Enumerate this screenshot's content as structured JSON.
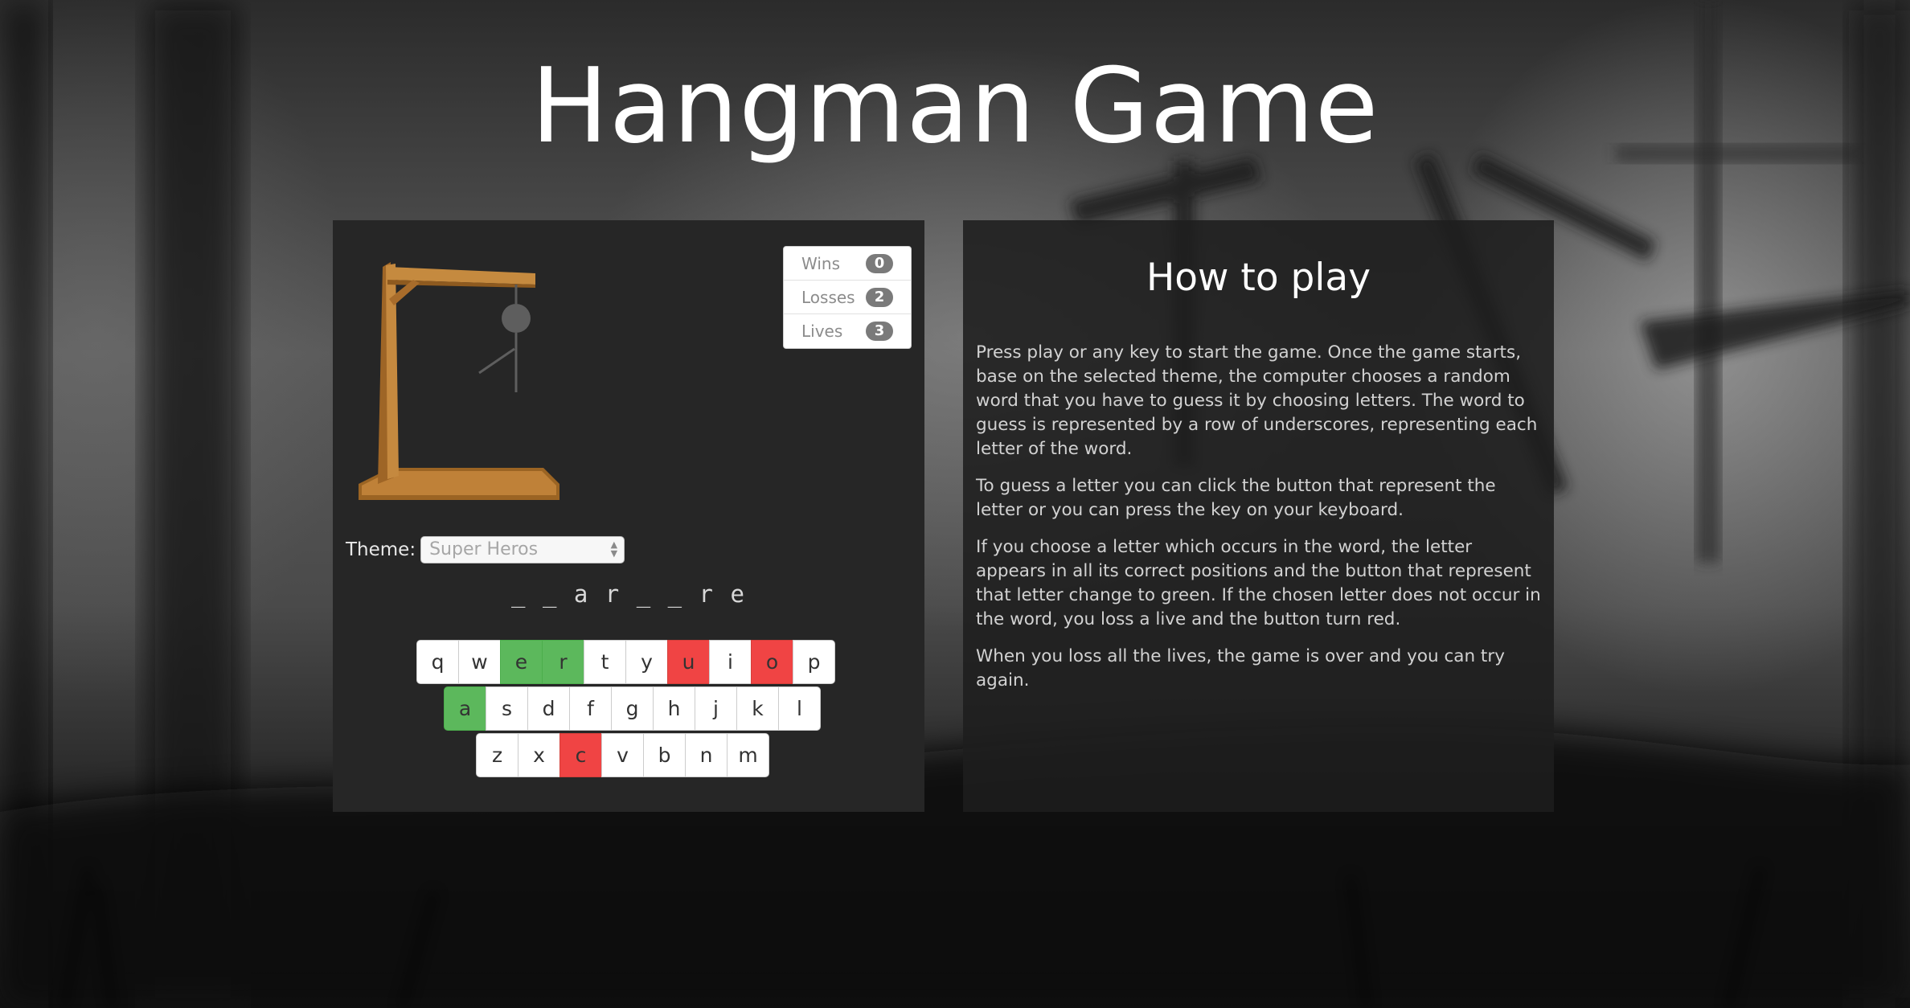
{
  "page": {
    "title": "Hangman Game"
  },
  "game": {
    "stats": [
      {
        "label": "Wins",
        "value": "0"
      },
      {
        "label": "Losses",
        "value": "2"
      },
      {
        "label": "Lives",
        "value": "3"
      }
    ],
    "theme": {
      "label": "Theme:",
      "selected": "Super Heros"
    },
    "word_display": "_ _ a r _ _ r e",
    "keyboard": {
      "rows": [
        [
          {
            "k": "q",
            "s": ""
          },
          {
            "k": "w",
            "s": ""
          },
          {
            "k": "e",
            "s": "correct"
          },
          {
            "k": "r",
            "s": "correct"
          },
          {
            "k": "t",
            "s": ""
          },
          {
            "k": "y",
            "s": ""
          },
          {
            "k": "u",
            "s": "wrong"
          },
          {
            "k": "i",
            "s": ""
          },
          {
            "k": "o",
            "s": "wrong"
          },
          {
            "k": "p",
            "s": ""
          }
        ],
        [
          {
            "k": "a",
            "s": "correct"
          },
          {
            "k": "s",
            "s": ""
          },
          {
            "k": "d",
            "s": ""
          },
          {
            "k": "f",
            "s": ""
          },
          {
            "k": "g",
            "s": ""
          },
          {
            "k": "h",
            "s": ""
          },
          {
            "k": "j",
            "s": ""
          },
          {
            "k": "k",
            "s": ""
          },
          {
            "k": "l",
            "s": ""
          }
        ],
        [
          {
            "k": "z",
            "s": ""
          },
          {
            "k": "x",
            "s": ""
          },
          {
            "k": "c",
            "s": "wrong"
          },
          {
            "k": "v",
            "s": ""
          },
          {
            "k": "b",
            "s": ""
          },
          {
            "k": "n",
            "s": ""
          },
          {
            "k": "m",
            "s": ""
          }
        ]
      ]
    },
    "colors": {
      "correct": "#5cb85c",
      "wrong": "#f04444",
      "wood": "#b77b33"
    }
  },
  "how_to_play": {
    "title": "How to play",
    "paragraphs": [
      "Press play or any key to start the game. Once the game starts, base on the selected theme, the computer chooses a random word that you have to guess it by choosing letters. The word to guess is represented by a row of underscores, representing each letter of the word.",
      "To guess a letter you can click the button that represent the letter or you can press the key on your keyboard.",
      "If you choose a letter which occurs in the word, the letter appears in all its correct positions and the button that represent that letter change to green. If the chosen letter does not occur in the word, you loss a live and the button turn red.",
      "When you loss all the lives, the game is over and you can try again."
    ]
  }
}
